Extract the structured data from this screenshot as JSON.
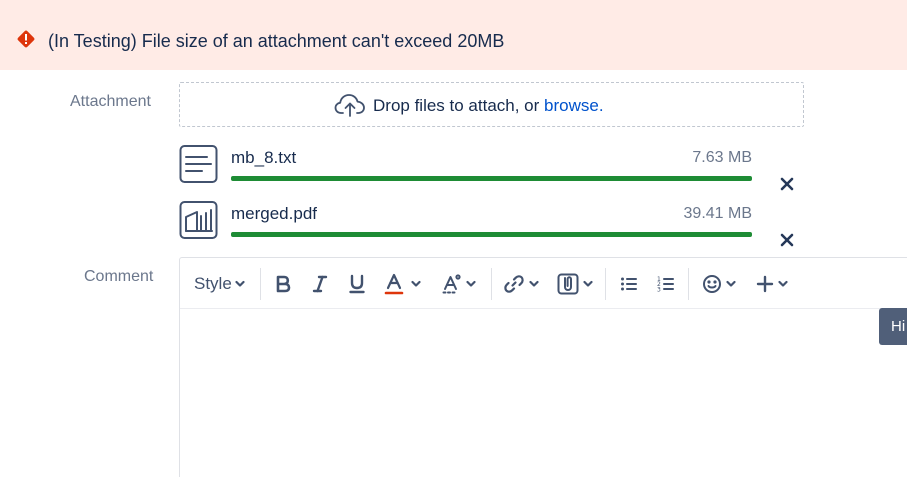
{
  "banner": {
    "message": "(In Testing) File size of an attachment can't exceed 20MB",
    "icon": "error-icon",
    "background": "#ffebe6",
    "icon_color": "#de350b"
  },
  "attachment": {
    "label": "Attachment",
    "dropzone": {
      "text": "Drop files to attach, or",
      "link": "browse.",
      "icon": "cloud-upload-icon"
    },
    "files": [
      {
        "name": "mb_8.txt",
        "size": "7.63 MB",
        "progress": 1.0,
        "icon": "text-file-icon"
      },
      {
        "name": "merged.pdf",
        "size": "39.41 MB",
        "progress": 1.0,
        "icon": "pdf-file-icon"
      }
    ],
    "progress_color": "#1e8c35"
  },
  "comment": {
    "label": "Comment",
    "toolbar": {
      "style_label": "Style",
      "items": [
        "bold",
        "italic",
        "underline",
        "text-color",
        "more-formatting",
        "link",
        "attachment",
        "bullet-list",
        "numbered-list",
        "emoji",
        "insert"
      ]
    },
    "tooltip": "Hi"
  }
}
